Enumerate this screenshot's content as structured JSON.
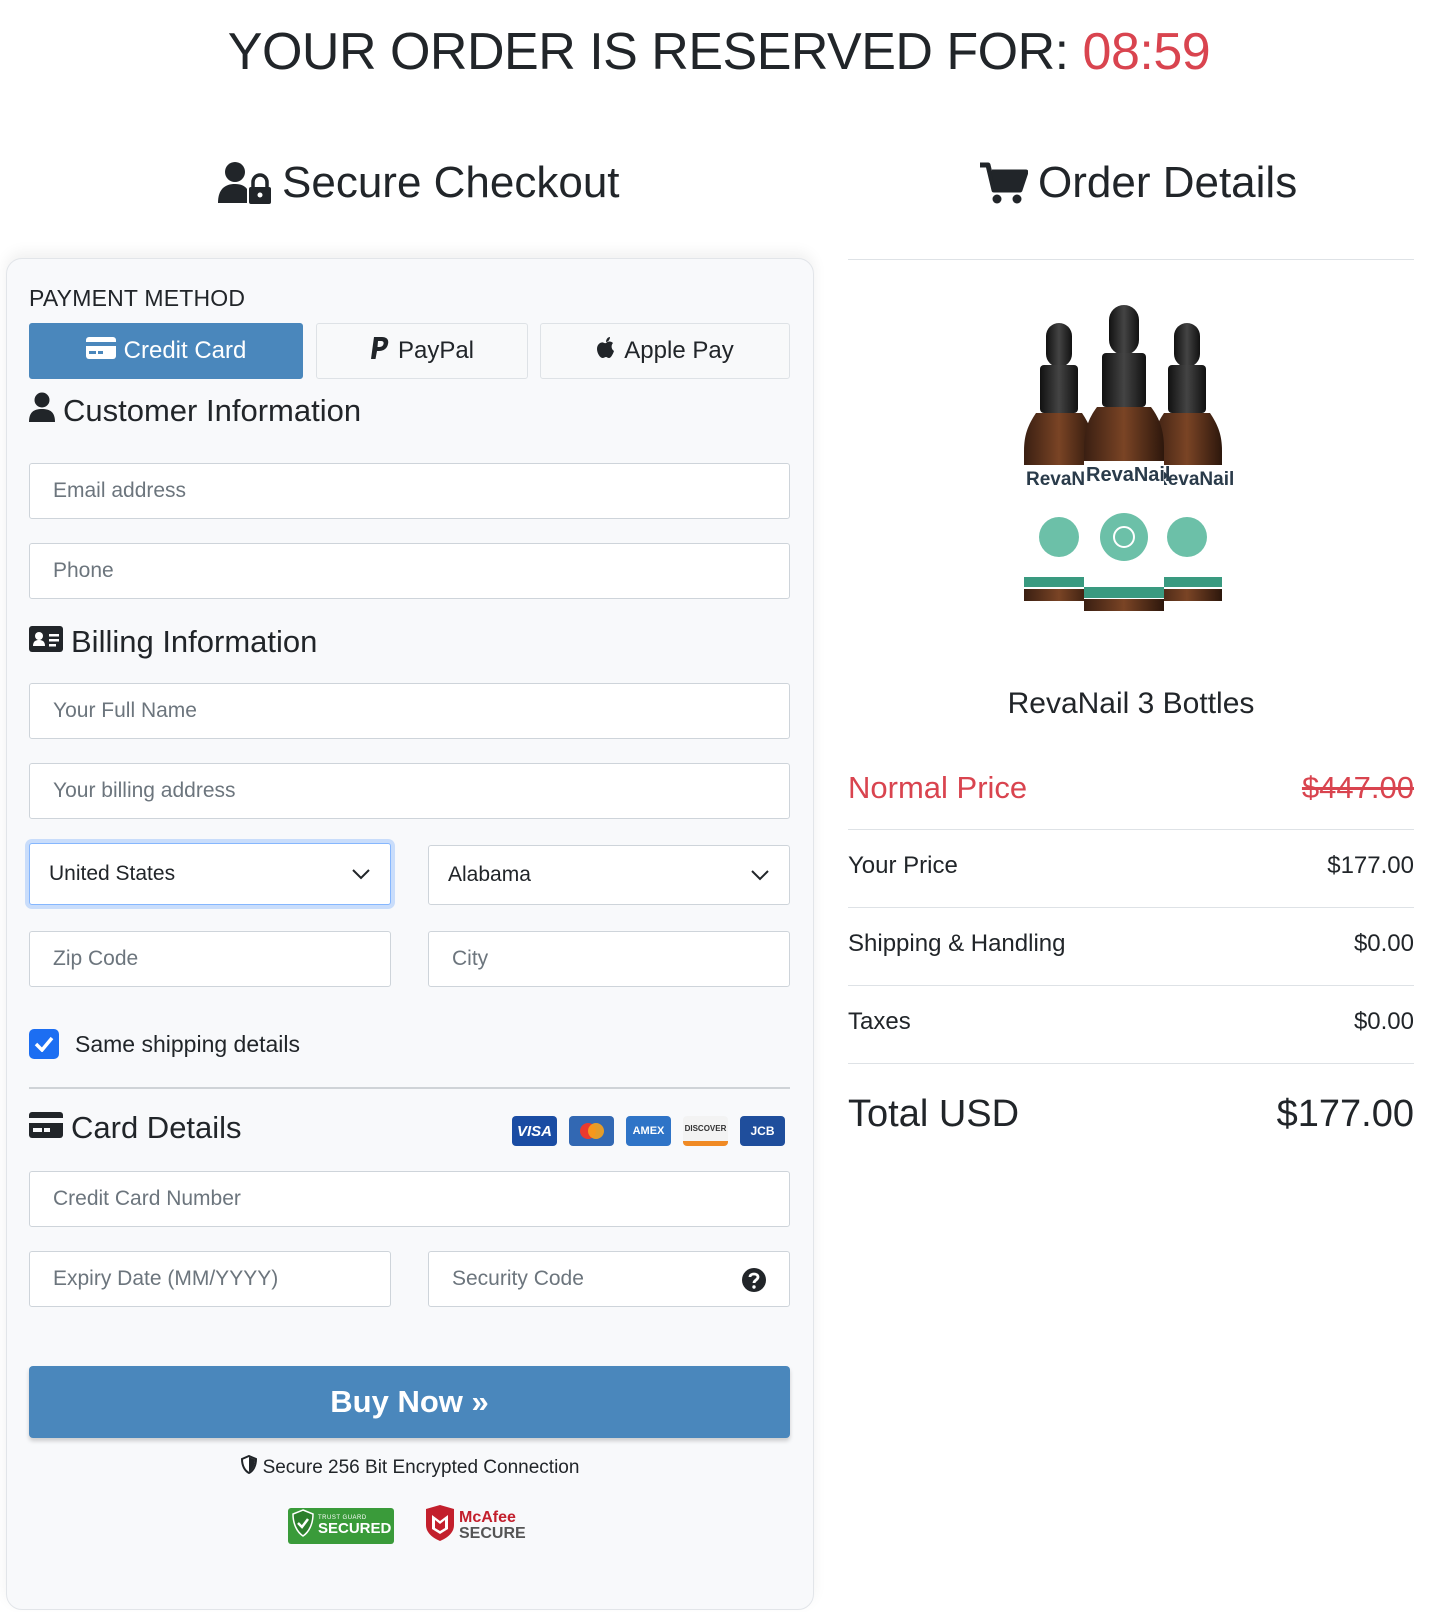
{
  "timer": {
    "prefix": "YOUR ORDER IS RESERVED FOR: ",
    "time": "08:59"
  },
  "checkout": {
    "title": "Secure Checkout",
    "payment_method_label": "PAYMENT METHOD",
    "methods": [
      {
        "label": "Credit Card",
        "icon": "credit-card-icon",
        "active": true
      },
      {
        "label": "PayPal",
        "icon": "paypal-icon",
        "active": false
      },
      {
        "label": "Apple Pay",
        "icon": "apple-icon",
        "active": false
      }
    ],
    "customer_title": "Customer Information",
    "email_placeholder": "Email address",
    "phone_placeholder": "Phone",
    "billing_title": "Billing Information",
    "fullname_placeholder": "Your Full Name",
    "address_placeholder": "Your billing address",
    "country_value": "United States",
    "state_value": "Alabama",
    "zip_placeholder": "Zip Code",
    "city_placeholder": "City",
    "same_shipping_label": "Same shipping details",
    "same_shipping_checked": true,
    "card_title": "Card Details",
    "card_brands": [
      "VISA",
      "MC",
      "AMEX",
      "DISCOVER",
      "JCB"
    ],
    "card_number_placeholder": "Credit Card Number",
    "expiry_placeholder": "Expiry Date (MM/YYYY)",
    "cvv_placeholder": "Security Code",
    "buy_label": "Buy Now »",
    "secure_text": "Secure 256 Bit Encrypted Connection",
    "badges": {
      "trust_guard_small": "TRUST GUARD",
      "trust_guard_big": "SECURED",
      "mcafee_top": "McAfee",
      "mcafee_bottom": "SECURE"
    }
  },
  "order": {
    "title": "Order Details",
    "product_name": "RevaNail 3 Bottles",
    "product_label": "RevaNail",
    "normal_price_label": "Normal Price",
    "normal_price": "$447.00",
    "rows": [
      {
        "label": "Your Price",
        "value": "$177.00"
      },
      {
        "label": "Shipping & Handling",
        "value": "$0.00"
      },
      {
        "label": "Taxes",
        "value": "$0.00"
      }
    ],
    "total_label": "Total USD",
    "total_value": "$177.00"
  },
  "colors": {
    "accent": "#4a87bc",
    "alert": "#d9444f",
    "checkbox": "#1c6ef2",
    "label_teal": "#2f9e8f"
  }
}
